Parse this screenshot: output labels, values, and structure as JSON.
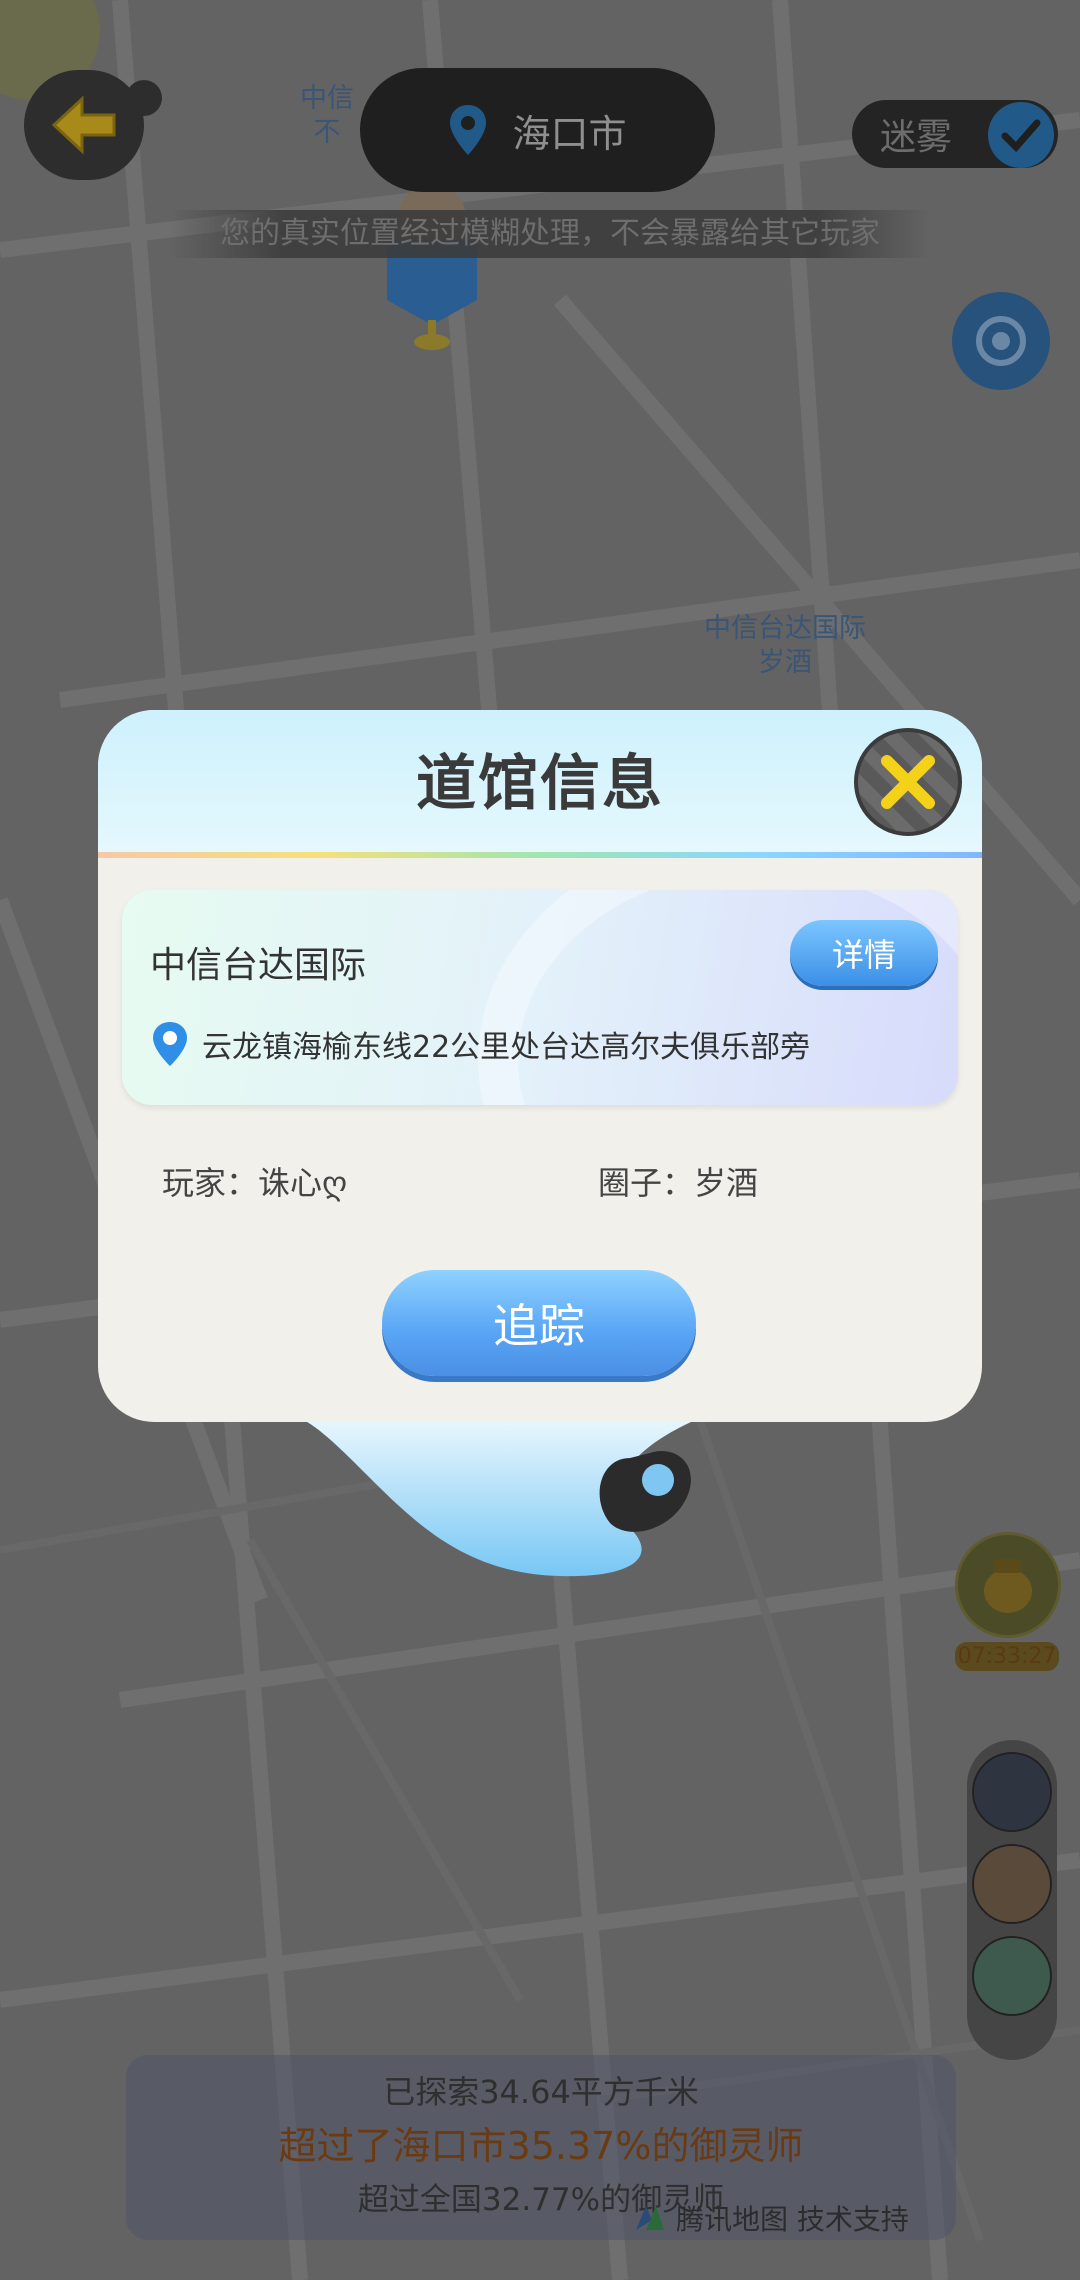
{
  "top_bar": {
    "city": "海口市",
    "fog_label": "迷雾",
    "privacy_note": "您的真实位置经过模糊处理，不会暴露给其它玩家"
  },
  "map_labels": {
    "top_left_gym": "中信\n不",
    "gym_label_line1": "中信台达国际",
    "gym_label_line2": "岁酒"
  },
  "dialog": {
    "title": "道馆信息",
    "gym_name": "中信台达国际",
    "detail_label": "详情",
    "address": "云龙镇海榆东线22公里处台达高尔夫俱乐部旁",
    "player_label": "玩家：诛心ღ",
    "circle_label": "圈子：岁酒",
    "track_label": "追踪"
  },
  "right_rail": {
    "timer": "07:33:27"
  },
  "stats": {
    "explored": "已探索34.64平方千米",
    "city_rank": "超过了海口市35.37%的御灵师",
    "national_rank": "超过全国32.77%的御灵师"
  },
  "attribution": "腾讯地图 技术支持",
  "colors": {
    "accent_blue": "#4b8fe4",
    "close_yellow": "#f5d21a",
    "back_arrow_yellow": "#f2c21c"
  }
}
